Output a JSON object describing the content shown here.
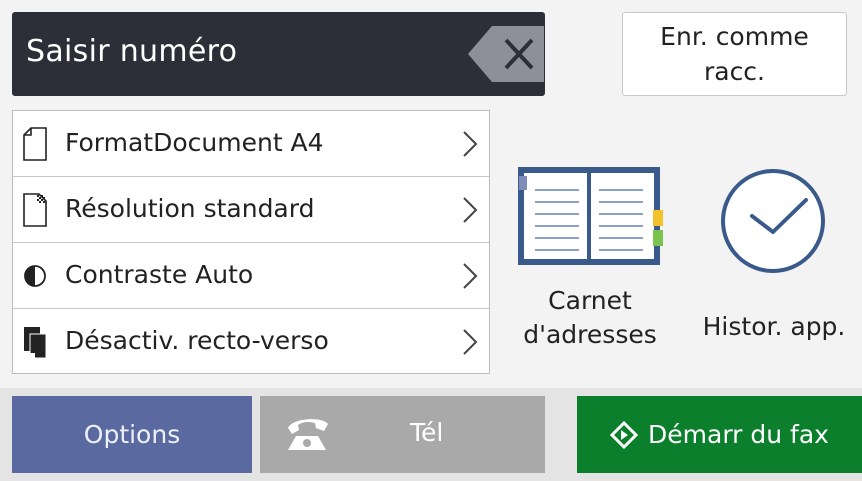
{
  "entry": {
    "label": "Saisir numéro"
  },
  "shortcut": {
    "line1": "Enr. comme",
    "line2": "racc."
  },
  "settings": [
    {
      "label": "FormatDocument A4",
      "icon": "page-icon"
    },
    {
      "label": "Résolution standard",
      "icon": "resolution-page-icon"
    },
    {
      "label": "Contraste Auto",
      "icon": "contrast-icon"
    },
    {
      "label": "Désactiv. recto-verso",
      "icon": "duplex-icon"
    }
  ],
  "tiles": {
    "address_book": {
      "line1": "Carnet",
      "line2": "d'adresses",
      "icon": "address-book-icon"
    },
    "history": {
      "label": "Histor. app.",
      "icon": "clock-icon"
    }
  },
  "bottom": {
    "options": "Options",
    "tel": "Tél",
    "fax": "Démarr du fax"
  },
  "colors": {
    "entry_bg": "#2c2f38",
    "options_bg": "#5a6aa0",
    "tel_bg": "#a9a9a9",
    "fax_bg": "#0b7f2b",
    "accent_blue": "#3a5a8c"
  }
}
